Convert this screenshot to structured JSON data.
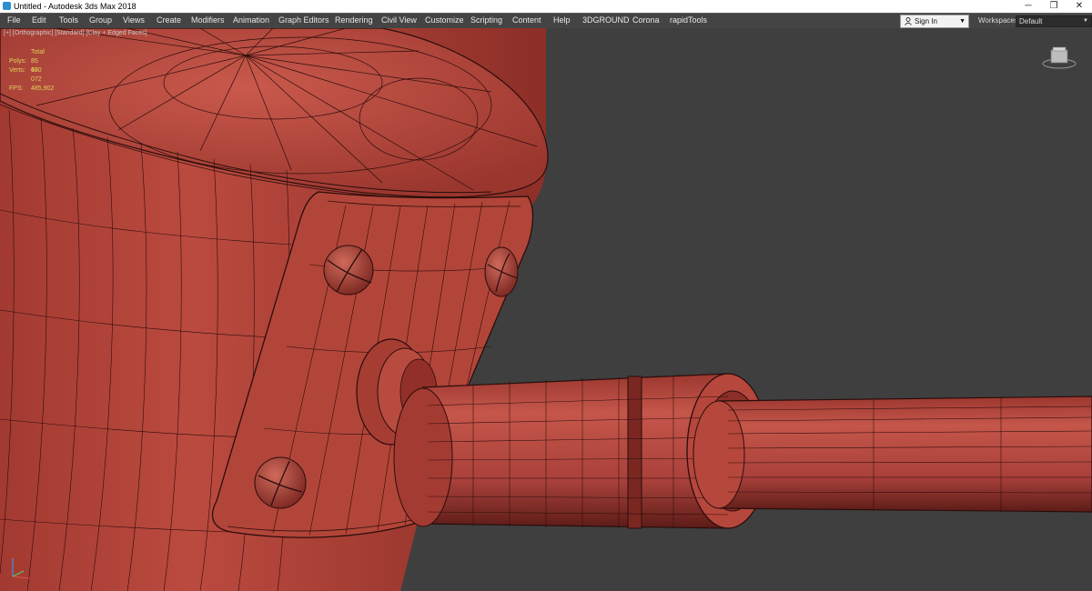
{
  "window": {
    "title": "Untitled - Autodesk 3ds Max 2018",
    "minimize": "─",
    "maximize": "❐",
    "close": "✕"
  },
  "menu": [
    "File",
    "Edit",
    "Tools",
    "Group",
    "Views",
    "Create",
    "Modifiers",
    "Animation",
    "Graph Editors",
    "Rendering",
    "Civil View",
    "Customize",
    "Scripting",
    "Content",
    "Help",
    "3DGROUND",
    "Corona",
    "rapidTools"
  ],
  "account": {
    "sign_in": "Sign In",
    "icon": "person-icon"
  },
  "workspaces": {
    "label": "Workspaces:",
    "value": "Default"
  },
  "viewport": {
    "label": "[+] [Orthographic] [Standard] [Clay + Edged Faces]",
    "stats": {
      "header": "Total",
      "rows": [
        {
          "key": "Polys:",
          "value": "85 680"
        },
        {
          "key": "Verts:",
          "value": "43 072"
        },
        {
          "key": "FPS:",
          "value": "485,902"
        }
      ]
    }
  },
  "colors": {
    "menubar": "#444444",
    "viewport_bg": "#3f3f3f",
    "model": "#b8483d",
    "wire": "#2a0d0b",
    "stats_text": "#e0d35a"
  }
}
